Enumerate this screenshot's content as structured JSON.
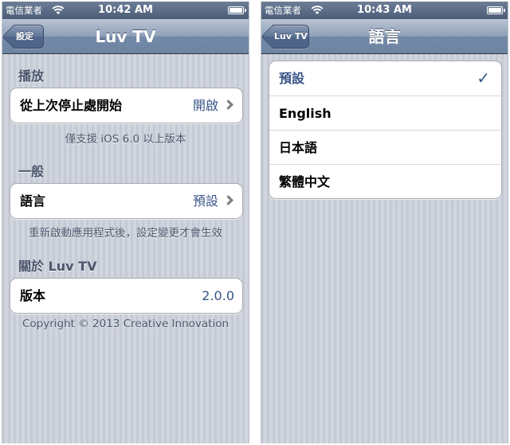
{
  "left_screen": {
    "status_bar": {
      "carrier": "電信業者",
      "time": "10:42 AM",
      "battery_level": 1.0
    },
    "nav": {
      "back_label": "設定",
      "title": "Luv TV"
    },
    "sections": {
      "playback": {
        "header": "播放",
        "row_label": "從上次停止處開始",
        "row_value": "開啟",
        "footer": "僅支援 iOS 6.0 以上版本"
      },
      "general": {
        "header": "一般",
        "row_label": "語言",
        "row_value": "預設",
        "footer": "重新啟動應用程式後，設定變更才會生效"
      },
      "about": {
        "header": "關於 Luv TV",
        "row_label": "版本",
        "row_value": "2.0.0",
        "footer": "Copyright © 2013 Creative Innovation"
      }
    }
  },
  "right_screen": {
    "status_bar": {
      "carrier": "電信業者",
      "time": "10:43 AM",
      "battery_level": 1.0
    },
    "nav": {
      "back_label": "Luv TV",
      "title": "語言"
    },
    "languages": [
      "預設",
      "English",
      "日本語",
      "繁體中文"
    ],
    "selected_language": "預設",
    "check_mark": "✓"
  },
  "colors": {
    "value_blue": "#385487",
    "nav_bar": "#6e84a3",
    "section_text": "#4c566c"
  }
}
